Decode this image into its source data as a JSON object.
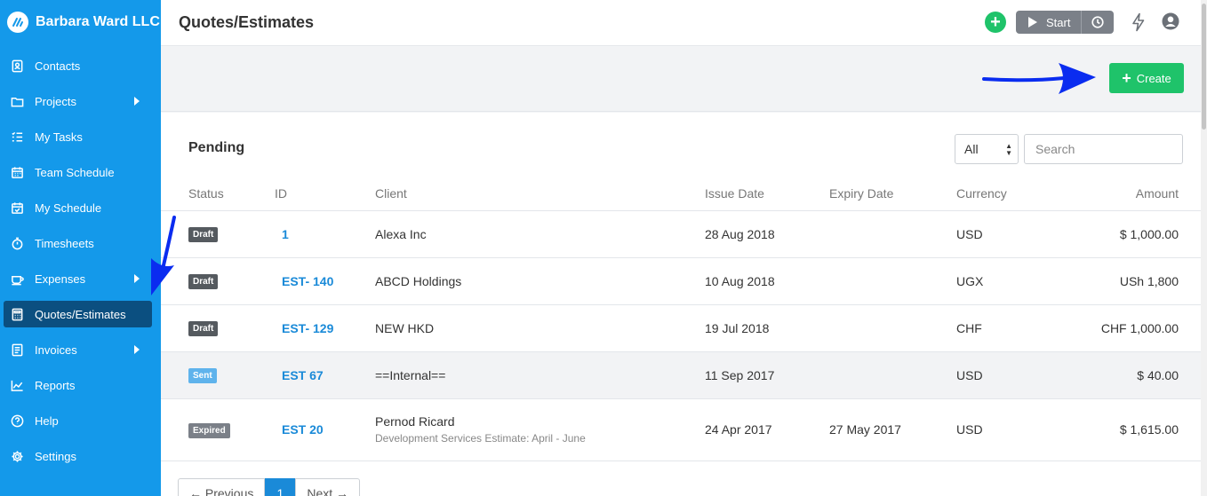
{
  "brand": {
    "name": "Barbara Ward LLC"
  },
  "sidebar": {
    "items": [
      {
        "label": "Contacts",
        "icon": "contacts-icon",
        "has_submenu": false
      },
      {
        "label": "Projects",
        "icon": "folder-icon",
        "has_submenu": true
      },
      {
        "label": "My Tasks",
        "icon": "tasks-icon",
        "has_submenu": false
      },
      {
        "label": "Team Schedule",
        "icon": "calendar-icon",
        "has_submenu": false
      },
      {
        "label": "My Schedule",
        "icon": "calendar-check-icon",
        "has_submenu": false
      },
      {
        "label": "Timesheets",
        "icon": "stopwatch-icon",
        "has_submenu": false
      },
      {
        "label": "Expenses",
        "icon": "coffee-icon",
        "has_submenu": true
      },
      {
        "label": "Quotes/Estimates",
        "icon": "calculator-icon",
        "has_submenu": false,
        "active": true
      },
      {
        "label": "Invoices",
        "icon": "invoice-icon",
        "has_submenu": true
      },
      {
        "label": "Reports",
        "icon": "chart-icon",
        "has_submenu": false
      },
      {
        "label": "Help",
        "icon": "help-icon",
        "has_submenu": false
      },
      {
        "label": "Settings",
        "icon": "gear-icon",
        "has_submenu": false
      }
    ]
  },
  "header": {
    "title": "Quotes/Estimates",
    "quick_add": "+",
    "timer_label": "Start"
  },
  "actions": {
    "create_label": "Create"
  },
  "section": {
    "title": "Pending",
    "filter_value": "All",
    "search_placeholder": "Search"
  },
  "table": {
    "columns": [
      "Status",
      "ID",
      "Client",
      "Issue Date",
      "Expiry Date",
      "Currency",
      "Amount"
    ],
    "rows": [
      {
        "status": "Draft",
        "id": "1",
        "client": "Alexa Inc",
        "client_sub": "",
        "issue_date": "28 Aug 2018",
        "expiry_date": "",
        "currency": "USD",
        "amount": "$ 1,000.00"
      },
      {
        "status": "Draft",
        "id": "EST- 140",
        "client": "ABCD Holdings",
        "client_sub": "",
        "issue_date": "10 Aug 2018",
        "expiry_date": "",
        "currency": "UGX",
        "amount": "USh 1,800"
      },
      {
        "status": "Draft",
        "id": "EST- 129",
        "client": "NEW HKD",
        "client_sub": "",
        "issue_date": "19 Jul 2018",
        "expiry_date": "",
        "currency": "CHF",
        "amount": "CHF 1,000.00"
      },
      {
        "status": "Sent",
        "id": "EST 67",
        "client": "==Internal==",
        "client_sub": "",
        "issue_date": "11 Sep 2017",
        "expiry_date": "",
        "currency": "USD",
        "amount": "$ 40.00"
      },
      {
        "status": "Expired",
        "id": "EST 20",
        "client": "Pernod Ricard",
        "client_sub": "Development Services Estimate: April - June",
        "issue_date": "24 Apr 2017",
        "expiry_date": "27 May 2017",
        "currency": "USD",
        "amount": "$ 1,615.00"
      }
    ]
  },
  "pagination": {
    "prev": "← Previous",
    "current": "1",
    "next": "Next →"
  },
  "colors": {
    "sidebar": "#1499ea",
    "active_item": "#0b4f80",
    "green": "#1fc36a",
    "link": "#1a8ad8",
    "annotation_arrow": "#0a2cf0"
  }
}
